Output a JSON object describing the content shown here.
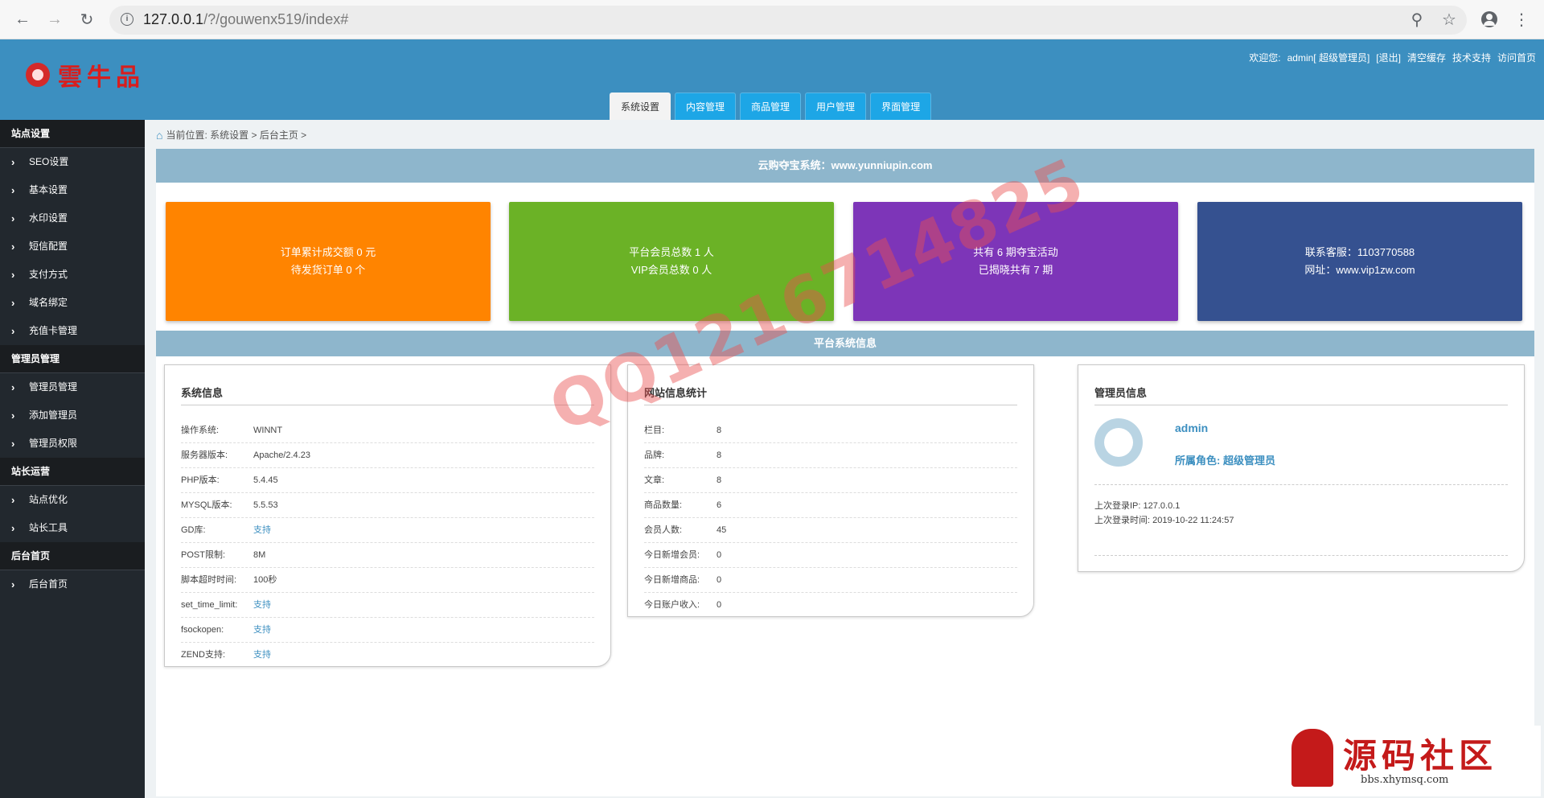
{
  "browser": {
    "url_host": "127.0.0.1",
    "url_path": "/?/gouwenx519/index#"
  },
  "header": {
    "logo_text": "雲牛品",
    "links": [
      "欢迎您:",
      "admin[ 超级管理员]",
      "[退出]",
      "清空缓存",
      "技术支持",
      "访问首页"
    ],
    "tabs": [
      "系统设置",
      "内容管理",
      "商品管理",
      "用户管理",
      "界面管理"
    ],
    "active_tab": "系统设置"
  },
  "sidebar": {
    "groups": [
      {
        "title": "站点设置",
        "items": [
          "SEO设置",
          "基本设置",
          "水印设置",
          "短信配置",
          "支付方式",
          "域名绑定",
          "充值卡管理"
        ]
      },
      {
        "title": "管理员管理",
        "items": [
          "管理员管理",
          "添加管理员",
          "管理员权限"
        ]
      },
      {
        "title": "站长运营",
        "items": [
          "站点优化",
          "站长工具"
        ]
      },
      {
        "title": "后台首页",
        "items": [
          "后台首页"
        ]
      }
    ]
  },
  "breadcrumb": "当前位置: 系统设置 > 后台主页 >",
  "banner_title": "云购夺宝系统：www.yunniupin.com",
  "stats": [
    {
      "line1": "订单累计成交额 0 元",
      "line2": "待发货订单 0 个",
      "color": "#ff8400"
    },
    {
      "line1": "平台会员总数 1 人",
      "line2": "VIP会员总数 0 人",
      "color": "#6bb226"
    },
    {
      "line1": "共有 6 期夺宝活动",
      "line2": "已揭晓共有 7 期",
      "color": "#7d35b8"
    },
    {
      "line1": "联系客服：1103770588",
      "line2": "网址：www.vip1zw.com",
      "color": "#355190"
    }
  ],
  "section_title": "平台系统信息",
  "system_info": {
    "title": "系统信息",
    "rows": [
      {
        "k": "操作系统:",
        "v": "WINNT"
      },
      {
        "k": "服务器版本:",
        "v": "Apache/2.4.23"
      },
      {
        "k": "PHP版本:",
        "v": "5.4.45"
      },
      {
        "k": "MYSQL版本:",
        "v": "5.5.53"
      },
      {
        "k": "GD库:",
        "v": "支持"
      },
      {
        "k": "POST限制:",
        "v": "8M"
      },
      {
        "k": "脚本超时时间:",
        "v": "100秒"
      },
      {
        "k": "set_time_limit:",
        "v": "支持"
      },
      {
        "k": "fsockopen:",
        "v": "支持"
      },
      {
        "k": "ZEND支持:",
        "v": "支持"
      }
    ]
  },
  "site_stats": {
    "title": "网站信息统计",
    "rows": [
      {
        "k": "栏目:",
        "v": "8"
      },
      {
        "k": "品牌:",
        "v": "8"
      },
      {
        "k": "文章:",
        "v": "8"
      },
      {
        "k": "商品数量:",
        "v": "6"
      },
      {
        "k": "会员人数:",
        "v": "45"
      },
      {
        "k": "今日新增会员:",
        "v": "0"
      },
      {
        "k": "今日新增商品:",
        "v": "0"
      },
      {
        "k": "今日账户收入:",
        "v": "0"
      }
    ]
  },
  "admin_info": {
    "title": "管理员信息",
    "name": "admin",
    "role": "所属角色: 超级管理员",
    "last_ip": "上次登录IP: 127.0.0.1",
    "last_time": "上次登录时间: 2019-10-22 11:24:57"
  },
  "watermark": "QQ1216714825",
  "brand_watermark": {
    "cn": "源码社区",
    "url": "bbs.xhymsq.com"
  },
  "colors": {
    "header": "#3c8fc0",
    "sidebar": "#22282e",
    "banner": "#8eb6cc",
    "link": "#3c8fc0"
  }
}
